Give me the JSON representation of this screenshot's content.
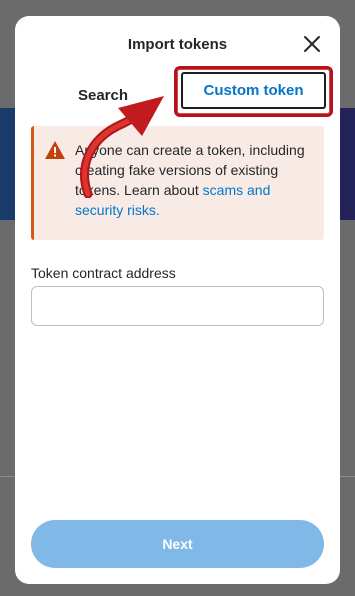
{
  "modal": {
    "title": "Import tokens",
    "close_icon": "close-icon"
  },
  "tabs": [
    {
      "label": "Search",
      "active": false
    },
    {
      "label": "Custom token",
      "active": true
    }
  ],
  "warning": {
    "icon": "warning-icon",
    "text": "Anyone can create a token, including creating fake versions of existing tokens. Learn about",
    "link": "scams and security risks."
  },
  "form": {
    "address_label": "Token contract address",
    "address_value": "",
    "address_placeholder": ""
  },
  "footer": {
    "next_label": "Next"
  },
  "colors": {
    "accent": "#0376c9",
    "warning_bg": "#f8ebe6",
    "warning_border": "#d15a1a",
    "next_button_disabled": "#80b8e8",
    "annotation_red": "#b5121b"
  }
}
